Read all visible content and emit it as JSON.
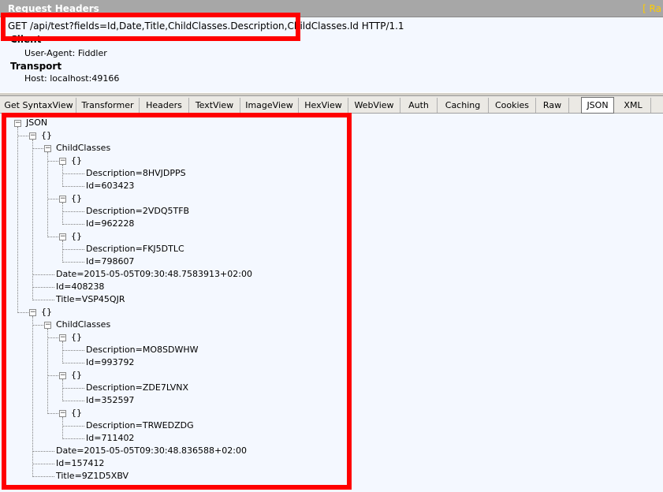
{
  "header": {
    "title": "Request Headers",
    "link_fragment": "[ Ra"
  },
  "request": {
    "line": "GET /api/test?fields=Id,Date,Title,ChildClasses.Description,ChildClasses.Id HTTP/1.1",
    "groups": [
      {
        "label": "Client",
        "items": [
          "User-Agent: Fiddler"
        ]
      },
      {
        "label": "Transport",
        "items": [
          "Host: localhost:49166"
        ]
      }
    ]
  },
  "tabs": [
    "Get SyntaxView",
    "Transformer",
    "Headers",
    "TextView",
    "ImageView",
    "HexView",
    "WebView",
    "Auth",
    "Caching",
    "Cookies",
    "Raw",
    "JSON",
    "XML"
  ],
  "active_tab": "JSON",
  "tree": {
    "root": "JSON",
    "object_label": "{}",
    "child_label": "ChildClasses",
    "objects": [
      {
        "children": [
          {
            "description": "Description=8HVJDPPS",
            "id": "Id=603423"
          },
          {
            "description": "Description=2VDQ5TFB",
            "id": "Id=962228"
          },
          {
            "description": "Description=FKJ5DTLC",
            "id": "Id=798607"
          }
        ],
        "date": "Date=2015-05-05T09:30:48.7583913+02:00",
        "id": "Id=408238",
        "title": "Title=VSP45QJR"
      },
      {
        "children": [
          {
            "description": "Description=MO8SDWHW",
            "id": "Id=993792"
          },
          {
            "description": "Description=ZDE7LVNX",
            "id": "Id=352597"
          },
          {
            "description": "Description=TRWEDZDG",
            "id": "Id=711402"
          }
        ],
        "date": "Date=2015-05-05T09:30:48.836588+02:00",
        "id": "Id=157412",
        "title": "Title=9Z1D5XBV"
      }
    ]
  },
  "colors": {
    "highlight": "#ff0000",
    "panel_bg": "#f4f8ff",
    "header_bg": "#a7a7a7"
  }
}
